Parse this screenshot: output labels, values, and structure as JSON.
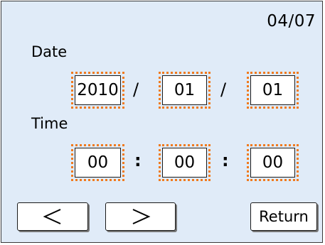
{
  "header": {
    "page_indicator": "04/07"
  },
  "date": {
    "label": "Date",
    "year": "2010",
    "month": "01",
    "day": "01",
    "separator": "/"
  },
  "time": {
    "label": "Time",
    "hour": "00",
    "minute": "00",
    "second": "00",
    "separator": ":"
  },
  "buttons": {
    "prev_icon": "chevron-left-icon",
    "next_icon": "chevron-right-icon",
    "return_label": "Return"
  },
  "colors": {
    "background": "#e0ebf8",
    "field_highlight": "#f07a1e"
  }
}
